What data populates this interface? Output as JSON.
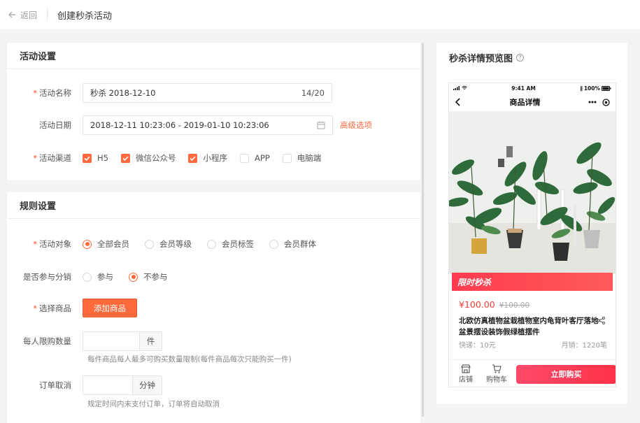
{
  "header": {
    "back_label": "返回",
    "title": "创建秒杀活动"
  },
  "activity": {
    "title": "活动设置",
    "name": {
      "label": "活动名称",
      "value": "秒杀  2018-12-10",
      "counter": "14/20"
    },
    "date": {
      "label": "活动日期",
      "value": "2018-12-11 10:23:06 - 2019-01-10 10:23:06",
      "advanced_link": "高级选项"
    },
    "channels": {
      "label": "活动渠道",
      "options": [
        {
          "label": "H5",
          "checked": true
        },
        {
          "label": "微信公众号",
          "checked": true
        },
        {
          "label": "小程序",
          "checked": true
        },
        {
          "label": "APP",
          "checked": false
        },
        {
          "label": "电脑端",
          "checked": false
        }
      ]
    }
  },
  "rules": {
    "title": "规则设置",
    "target": {
      "label": "活动对象",
      "options": [
        {
          "label": "全部会员",
          "selected": true
        },
        {
          "label": "会员等级",
          "selected": false
        },
        {
          "label": "会员标签",
          "selected": false
        },
        {
          "label": "会员群体",
          "selected": false
        }
      ]
    },
    "distribution": {
      "label": "是否参与分销",
      "options": [
        {
          "label": "参与",
          "selected": false
        },
        {
          "label": "不参与",
          "selected": true
        }
      ]
    },
    "product": {
      "label": "选择商品",
      "button": "添加商品"
    },
    "limit": {
      "label": "每人限购数量",
      "unit": "件",
      "value": "",
      "hint": "每件商品每人最多可购买数量限制(每件商品每次只能购买一件)"
    },
    "cancel": {
      "label": "订单取消",
      "unit": "分钟",
      "value": "",
      "hint": "规定时间内未支付订单，订单将自动取消"
    }
  },
  "preview": {
    "title": "秒杀详情预览图",
    "status_time": "9:41 AM",
    "battery": "100%",
    "nav_title": "商品详情",
    "flash_label": "限时秒杀",
    "price_now": "¥100.00",
    "price_old": "¥100.00",
    "product_name": "北欧仿真植物盆栽植物室内龟背叶客厅落地盆景摆设装饰假绿植摆件",
    "shipping": "快递：10元",
    "sales": "月销：1220笔",
    "tab_store": "店铺",
    "tab_cart": "购物车",
    "buy_button": "立即购买"
  },
  "colors": {
    "accent": "#ff6a3d",
    "flash": "#ff3c4f",
    "buy": "#ff3a5a"
  }
}
